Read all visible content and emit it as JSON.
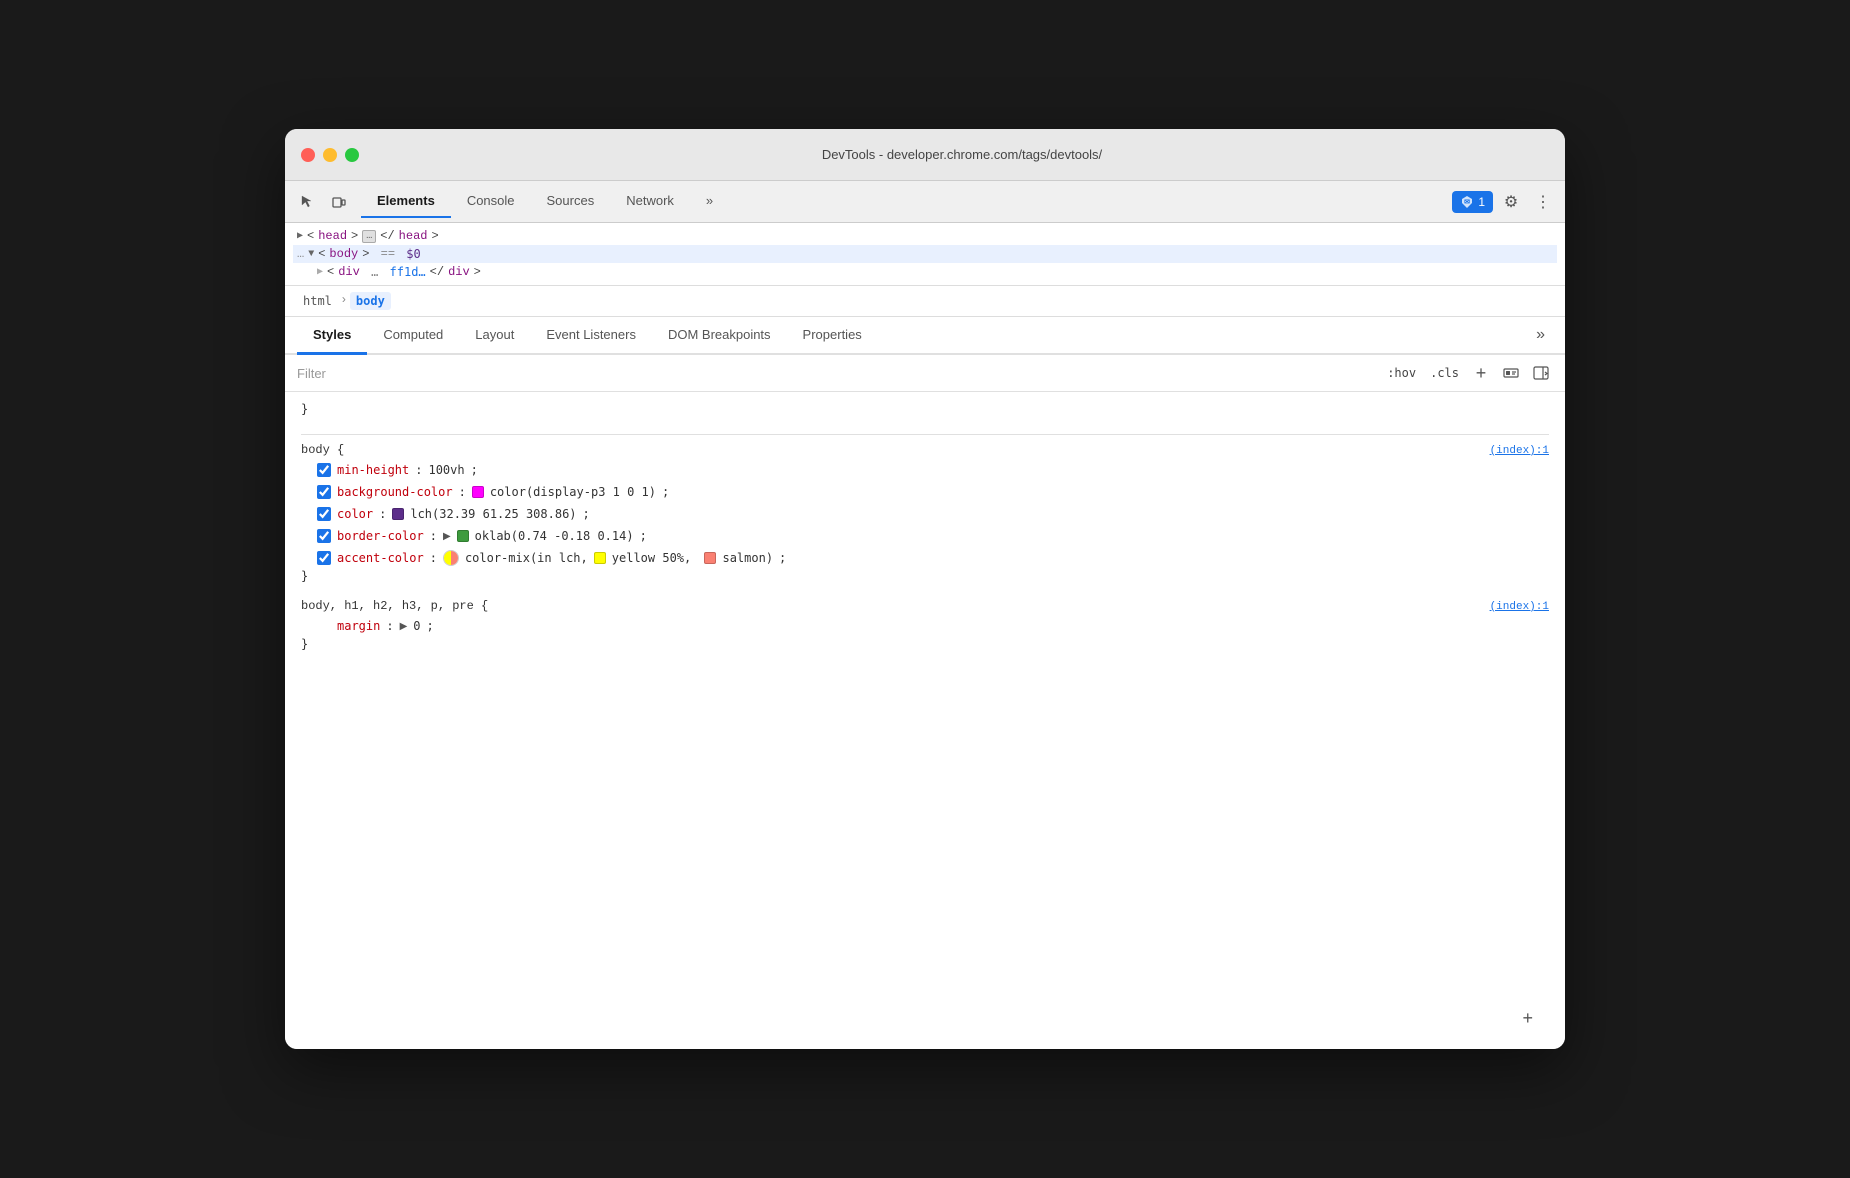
{
  "window": {
    "title": "DevTools - developer.chrome.com/tags/devtools/"
  },
  "traffic_lights": {
    "close_label": "close",
    "minimize_label": "minimize",
    "maximize_label": "maximize"
  },
  "toolbar": {
    "tabs": [
      {
        "id": "elements",
        "label": "Elements",
        "active": true
      },
      {
        "id": "console",
        "label": "Console",
        "active": false
      },
      {
        "id": "sources",
        "label": "Sources",
        "active": false
      },
      {
        "id": "network",
        "label": "Network",
        "active": false
      },
      {
        "id": "more",
        "label": "»",
        "active": false
      }
    ],
    "badge_label": "1",
    "inspect_icon": "⊡",
    "device_icon": "▭",
    "settings_icon": "⚙",
    "more_icon": "⋮"
  },
  "html_tree": {
    "head_line": "▶ <head> … </head>",
    "body_line": "… ▼ <body>  ==  $0",
    "body_partial": "▶  <div …  ff1d… </div>"
  },
  "breadcrumb": {
    "items": [
      {
        "tag": "html",
        "active": false
      },
      {
        "tag": "body",
        "active": true
      }
    ]
  },
  "styles_panel": {
    "tabs": [
      {
        "id": "styles",
        "label": "Styles",
        "active": true
      },
      {
        "id": "computed",
        "label": "Computed",
        "active": false
      },
      {
        "id": "layout",
        "label": "Layout",
        "active": false
      },
      {
        "id": "event-listeners",
        "label": "Event Listeners",
        "active": false
      },
      {
        "id": "dom-breakpoints",
        "label": "DOM Breakpoints",
        "active": false
      },
      {
        "id": "properties",
        "label": "Properties",
        "active": false
      },
      {
        "id": "more",
        "label": "»",
        "active": false
      }
    ],
    "filter_placeholder": "Filter",
    "hov_label": ":hov",
    "cls_label": ".cls",
    "add_rule_label": "+",
    "force_element_state_icon": "⊞",
    "toggle_sidebar_icon": "◀"
  },
  "css_rules": [
    {
      "id": "rule-comma",
      "selector": "}",
      "source": null,
      "props": []
    },
    {
      "id": "rule-body",
      "selector": "body {",
      "source": "(index):1",
      "props": [
        {
          "checked": true,
          "name": "min-height",
          "value": "100vh;",
          "color": null,
          "has_triangle": false
        },
        {
          "checked": true,
          "name": "background-color",
          "value": "color(display-p3 1 0 1);",
          "color": "#ff00ff",
          "has_triangle": false
        },
        {
          "checked": true,
          "name": "color",
          "value": "lch(32.39 61.25 308.86);",
          "color": "#5c2d8a",
          "has_triangle": false
        },
        {
          "checked": true,
          "name": "border-color",
          "value": "oklab(0.74 -0.18 0.14);",
          "color": "#3d9b3d",
          "has_triangle": true
        },
        {
          "checked": true,
          "name": "accent-color",
          "value": "color-mix(in lch,",
          "value2": "yellow 50%,",
          "value3": "salmon);",
          "color": null,
          "has_mix": true,
          "mix_color1": "#ffff00",
          "mix_color2": "#fa8072"
        }
      ],
      "closing": "}"
    },
    {
      "id": "rule-body-elements",
      "selector": "body, h1, h2, h3, p, pre {",
      "source": "(index):1",
      "props": [
        {
          "checked": null,
          "name": "margin",
          "value": "0;",
          "color": null,
          "has_triangle": true,
          "no_checkbox": true
        }
      ],
      "closing": "}"
    }
  ],
  "add_rule_symbol": "+"
}
